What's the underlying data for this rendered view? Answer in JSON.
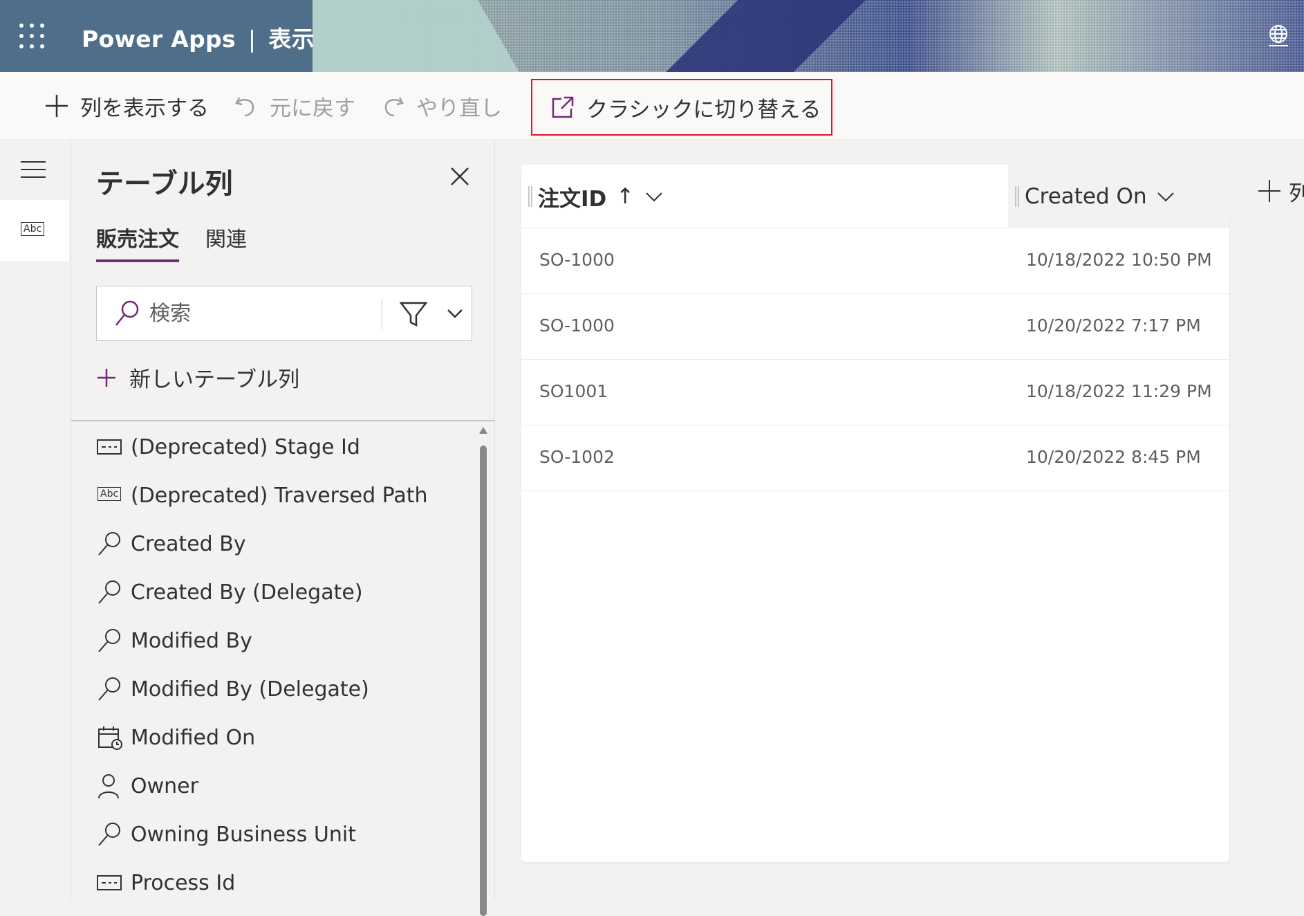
{
  "header": {
    "app_name": "Power Apps",
    "separator": "|",
    "view_name": "表示"
  },
  "toolbar": {
    "show_column": "列を表示する",
    "undo": "元に戻す",
    "redo": "やり直し",
    "switch_classic": "クラシックに切り替える"
  },
  "panel": {
    "title": "テーブル列",
    "tabs": [
      "販売注文",
      "関連"
    ],
    "search_placeholder": "検索",
    "new_column": "新しいテーブル列",
    "items": [
      {
        "label": "(Deprecated) Stage Id",
        "icon": "unique-id-icon"
      },
      {
        "label": "(Deprecated) Traversed Path",
        "icon": "text-abc-icon"
      },
      {
        "label": "Created By",
        "icon": "lookup-icon"
      },
      {
        "label": "Created By (Delegate)",
        "icon": "lookup-icon"
      },
      {
        "label": "Modified By",
        "icon": "lookup-icon"
      },
      {
        "label": "Modified By (Delegate)",
        "icon": "lookup-icon"
      },
      {
        "label": "Modified On",
        "icon": "calendar-icon"
      },
      {
        "label": "Owner",
        "icon": "person-icon"
      },
      {
        "label": "Owning Business Unit",
        "icon": "lookup-icon"
      },
      {
        "label": "Process Id",
        "icon": "unique-id-icon"
      }
    ]
  },
  "grid": {
    "columns": [
      "注文ID",
      "Created On"
    ],
    "sort_indicator": "↑",
    "rows": [
      [
        "SO-1000",
        "10/18/2022 10:50 PM"
      ],
      [
        "SO-1000",
        "10/20/2022 7:17 PM"
      ],
      [
        "SO1001",
        "10/18/2022 11:29 PM"
      ],
      [
        "SO-1002",
        "10/20/2022 8:45 PM"
      ]
    ],
    "add_column_label": "列"
  },
  "colors": {
    "accent": "#742774",
    "header_bg": "#4f6e89",
    "highlight_border": "#e81123"
  }
}
